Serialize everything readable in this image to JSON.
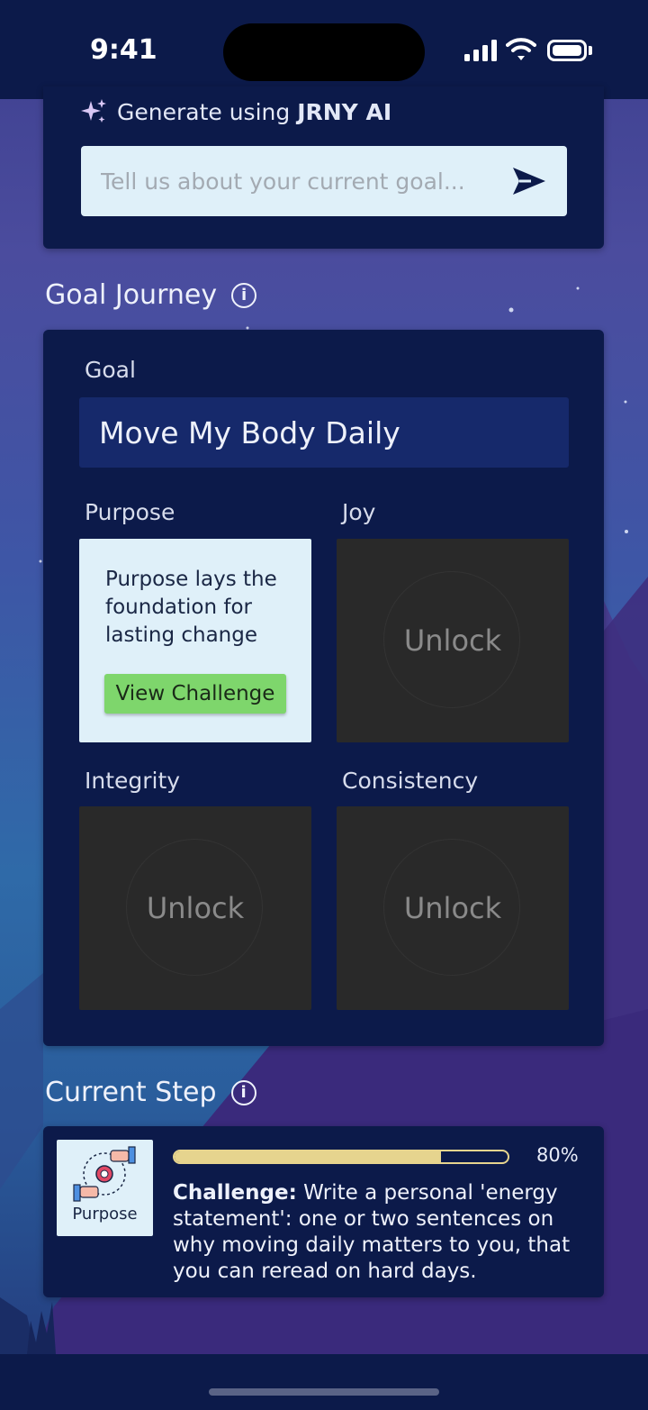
{
  "status_bar": {
    "time": "9:41"
  },
  "ai_generator": {
    "label_prefix": "Generate using ",
    "label_brand": "JRNY AI",
    "input_placeholder": "Tell us about your current goal..."
  },
  "goal_journey": {
    "title": "Goal Journey",
    "goal_label": "Goal",
    "goal_value": "Move My Body Daily",
    "cards": [
      {
        "label": "Purpose",
        "state": "unlocked",
        "text": "Purpose lays the foundation for lasting change",
        "button": "View Challenge"
      },
      {
        "label": "Joy",
        "state": "locked",
        "lock_text": "Unlock"
      },
      {
        "label": "Integrity",
        "state": "locked",
        "lock_text": "Unlock"
      },
      {
        "label": "Consistency",
        "state": "locked",
        "lock_text": "Unlock"
      }
    ]
  },
  "current_step": {
    "title": "Current Step",
    "thumb_label": "Purpose",
    "progress": 0.8,
    "progress_text": "80%",
    "challenge_prefix": "Challenge:",
    "challenge_text": " Write a personal 'energy statement': one or two sentences on why moving daily matters to you, that you can reread on hard days."
  },
  "icons": {
    "sparkle": "sparkle-icon",
    "send": "send-icon",
    "info": "info-icon"
  },
  "colors": {
    "panel": "#0c1a4a",
    "goal_box": "#16296b",
    "light_card": "#dff0f9",
    "locked_card": "#292929",
    "button_green": "#7ed66c",
    "progress_gold": "#e6d48e"
  }
}
